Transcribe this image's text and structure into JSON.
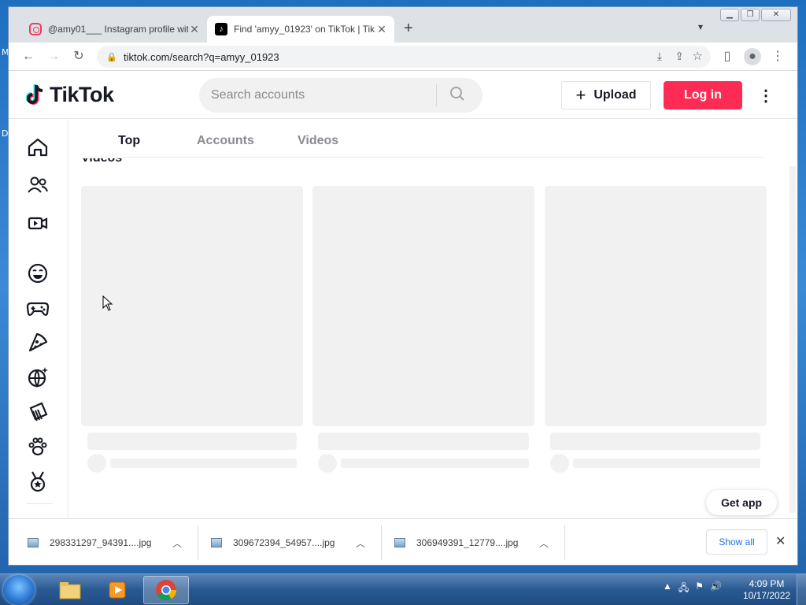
{
  "desktop": {
    "left_letters": [
      "M",
      "D"
    ]
  },
  "browser": {
    "tabs": [
      {
        "title": "@amy01___ Instagram profile wit",
        "icon": "instagram-icon"
      },
      {
        "title": "Find 'amyy_01923' on TikTok | Tik",
        "icon": "tiktok-icon"
      }
    ],
    "new_tab": "+",
    "address": "tiktok.com/search?q=amyy_01923"
  },
  "tiktok": {
    "logo_text": "TikTok",
    "search_placeholder": "Search accounts",
    "upload_label": "Upload",
    "login_label": "Log in",
    "tabs": [
      "Top",
      "Accounts",
      "Videos"
    ],
    "active_tab": "Top",
    "section_heading": "Videos",
    "sidebar_icons": [
      "home-icon",
      "following-icon",
      "live-icon",
      "comedy-icon",
      "gaming-icon",
      "food-icon",
      "travel-icon",
      "beauty-icon",
      "animals-icon",
      "sports-icon"
    ],
    "get_app_label": "Get app"
  },
  "downloads": {
    "items": [
      "298331297_94391....jpg",
      "309672394_54957....jpg",
      "306949391_12779....jpg"
    ],
    "show_all_label": "Show all"
  },
  "taskbar": {
    "time": "4:09 PM",
    "date": "10/17/2022",
    "apps": [
      "explorer-icon",
      "media-player-icon",
      "chrome-icon"
    ]
  },
  "colors": {
    "tiktok_red": "#fe2c55",
    "skeleton": "#f1f1f2",
    "chrome_blue": "#1a73e8"
  }
}
